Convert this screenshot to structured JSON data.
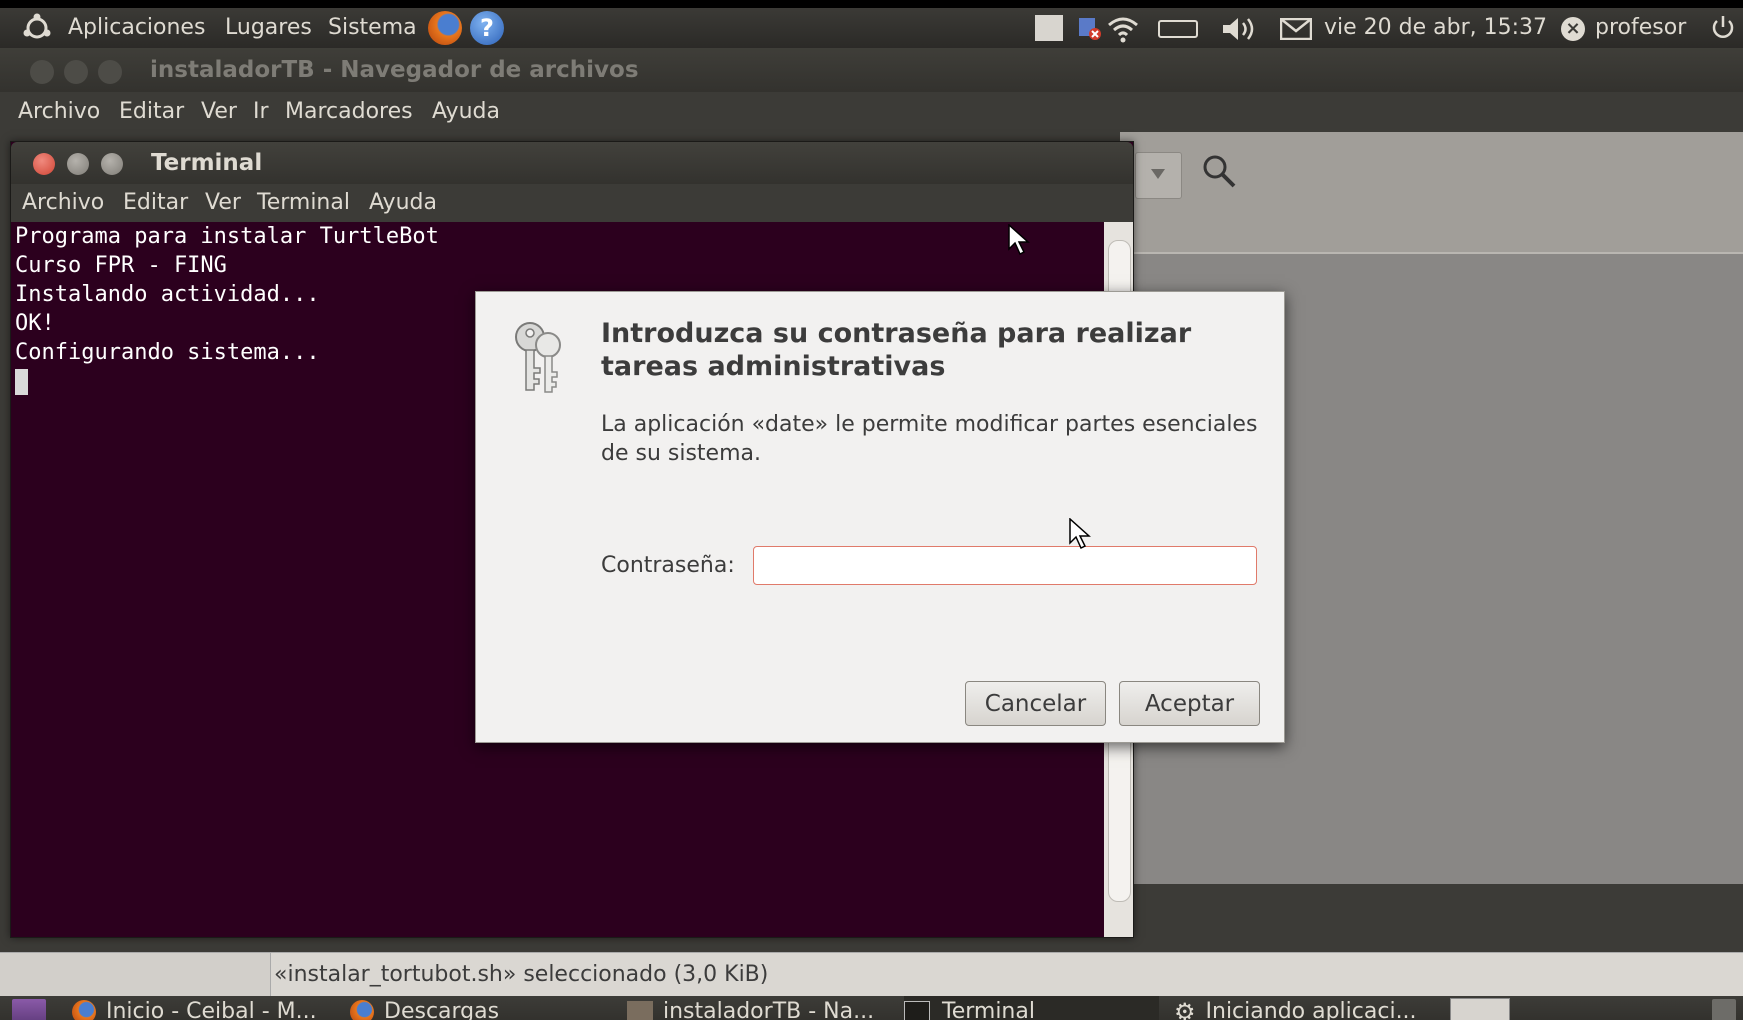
{
  "top_panel": {
    "menus": [
      "Aplicaciones",
      "Lugares",
      "Sistema"
    ],
    "clock": "vie 20 de abr, 15:37",
    "user": "profesor",
    "icons": [
      "ubuntu-logo-icon",
      "firefox-icon",
      "help-icon",
      "network-icon",
      "battery-icon",
      "volume-icon",
      "mail-icon",
      "user-status-icon",
      "power-icon"
    ]
  },
  "file_manager": {
    "title": "instaladorTB - Navegador de archivos",
    "menu": [
      "Archivo",
      "Editar",
      "Ver",
      "Ir",
      "Marcadores",
      "Ayuda"
    ],
    "status": "«instalar_tortubot.sh» seleccionado (3,0 KiB)"
  },
  "terminal": {
    "title": "Terminal",
    "menu": [
      "Archivo",
      "Editar",
      "Ver",
      "Terminal",
      "Ayuda"
    ],
    "lines": [
      "Programa para instalar TurtleBot",
      "Curso FPR - FING",
      "Instalando actividad...",
      "OK!",
      "Configurando sistema..."
    ]
  },
  "dialog": {
    "title": "Introduzca su contraseña para realizar tareas administrativas",
    "message": "La aplicación «date» le permite modificar partes esenciales de su sistema.",
    "password_label": "Contraseña:",
    "password_value": "",
    "cancel_label": "Cancelar",
    "ok_label": "Aceptar"
  },
  "bottom_panel": {
    "tasks": [
      "Inicio - Ceibal - M...",
      "Descargas",
      "instaladorTB - Na...",
      "Terminal",
      "Iniciando aplicaci..."
    ]
  },
  "colors": {
    "terminal_bg": "#2c001e",
    "panel_bg": "#3c3b37",
    "dialog_bg": "#f2f1f0",
    "close_button": "#e2574c"
  }
}
